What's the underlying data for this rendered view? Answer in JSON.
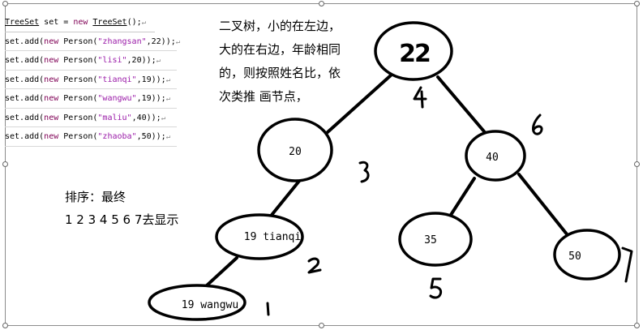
{
  "code": {
    "line0": {
      "type": "TreeSet",
      "var": " set = ",
      "kw": "new",
      "sp": " ",
      "ctor": "TreeSet",
      "end": "();"
    },
    "lines": [
      {
        "pre": "set.add(",
        "kw": "new",
        "mid": " Person(",
        "str": "\"zhangsan\"",
        "post": ",22));"
      },
      {
        "pre": "set.add(",
        "kw": "new",
        "mid": " Person(",
        "str": "\"lisi\"",
        "post": ",20));"
      },
      {
        "pre": "set.add(",
        "kw": "new",
        "mid": " Person(",
        "str": "\"tianqi\"",
        "post": ",19));"
      },
      {
        "pre": "set.add(",
        "kw": "new",
        "mid": " Person(",
        "str": "\"wangwu\"",
        "post": ",19));"
      },
      {
        "pre": "set.add(",
        "kw": "new",
        "mid": " Person(",
        "str": "\"maliu\"",
        "post": ",40));"
      },
      {
        "pre": "set.add(",
        "kw": "new",
        "mid": " Person(",
        "str": "\"zhaoba\"",
        "post": ",50));"
      }
    ],
    "return_mark": "↵"
  },
  "note": {
    "lines": [
      "二叉树，小的在左边，",
      "大的在右边，年龄相同",
      "的，则按照姓名比，依",
      "次类推 画节点，"
    ]
  },
  "sort": {
    "line1": "排序：最终",
    "line2": "1 2 3 4 5 6 7去显示"
  },
  "tree": {
    "root": "22",
    "n20": "20",
    "n40": "40",
    "n19t": "19 tianqi",
    "n19w": "19 wangwu",
    "n35": "35",
    "n50": "50"
  }
}
